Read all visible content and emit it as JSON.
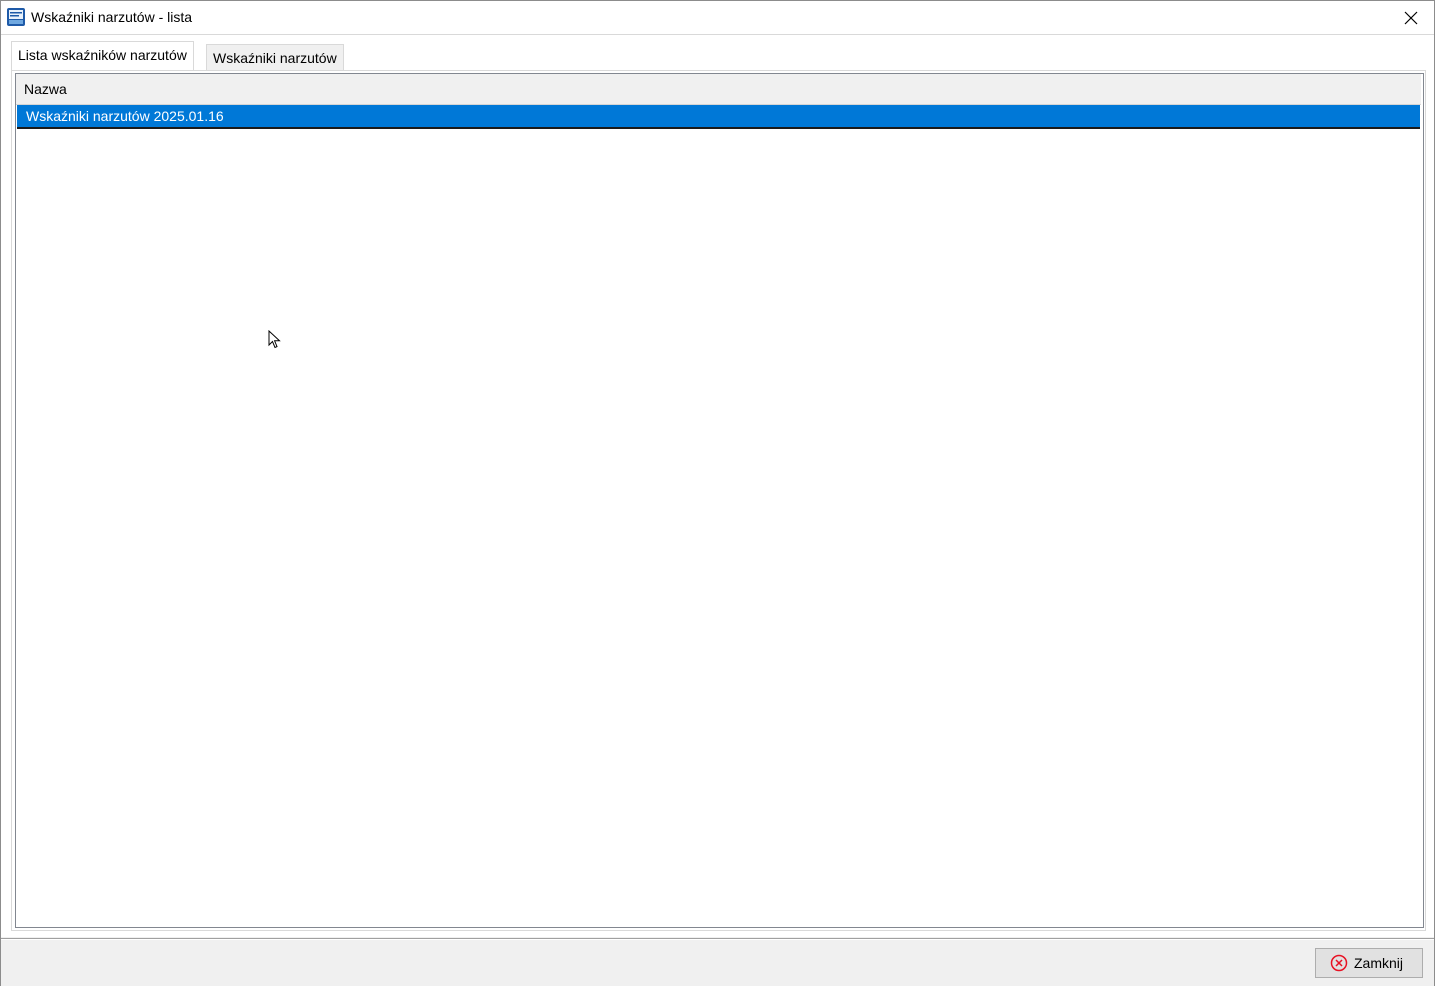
{
  "window": {
    "title": "Wskaźniki narzutów - lista"
  },
  "tabs": [
    {
      "label": "Lista wskaźników narzutów",
      "active": true
    },
    {
      "label": "Wskaźniki narzutów",
      "active": false
    }
  ],
  "grid": {
    "columns": [
      "Nazwa"
    ],
    "rows": [
      {
        "nazwa": "Wskaźniki narzutów 2025.01.16",
        "selected": true
      }
    ]
  },
  "footer": {
    "close_label": "Zamknij"
  },
  "colors": {
    "selection": "#0078d7",
    "close_icon": "#e81123"
  }
}
